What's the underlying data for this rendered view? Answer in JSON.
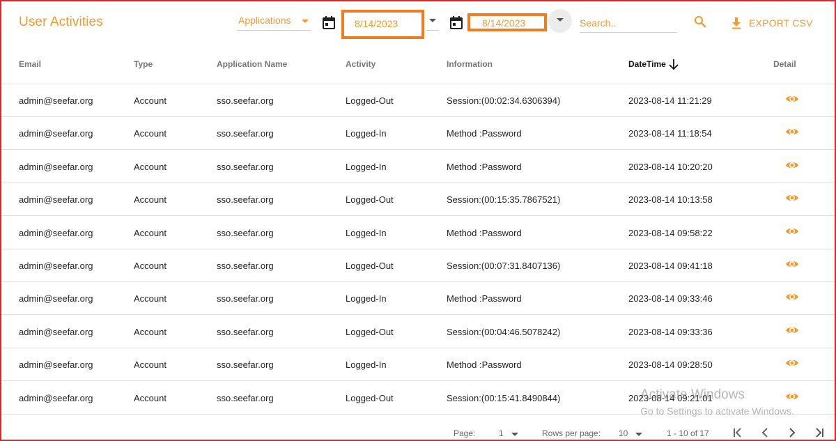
{
  "page_title": "User Activities",
  "filters": {
    "application_select": "Applications",
    "date_from": "8/14/2023",
    "date_to": "8/14/2023",
    "search_placeholder": "Search..",
    "export_label": "EXPORT CSV"
  },
  "table": {
    "headers": {
      "email": "Email",
      "type": "Type",
      "application": "Application Name",
      "activity": "Activity",
      "information": "Information",
      "datetime": "DateTime",
      "detail": "Detail"
    },
    "sort": {
      "column": "datetime",
      "direction": "descending"
    },
    "rows": [
      {
        "email": "admin@seefar.org",
        "type": "Account",
        "application": "sso.seefar.org",
        "activity": "Logged-Out",
        "information": "Session:(00:02:34.6306394)",
        "datetime": "2023-08-14 11:21:29"
      },
      {
        "email": "admin@seefar.org",
        "type": "Account",
        "application": "sso.seefar.org",
        "activity": "Logged-In",
        "information": "Method :Password",
        "datetime": "2023-08-14 11:18:54"
      },
      {
        "email": "admin@seefar.org",
        "type": "Account",
        "application": "sso.seefar.org",
        "activity": "Logged-In",
        "information": "Method :Password",
        "datetime": "2023-08-14 10:20:20"
      },
      {
        "email": "admin@seefar.org",
        "type": "Account",
        "application": "sso.seefar.org",
        "activity": "Logged-Out",
        "information": "Session:(00:15:35.7867521)",
        "datetime": "2023-08-14 10:13:58"
      },
      {
        "email": "admin@seefar.org",
        "type": "Account",
        "application": "sso.seefar.org",
        "activity": "Logged-In",
        "information": "Method :Password",
        "datetime": "2023-08-14 09:58:22"
      },
      {
        "email": "admin@seefar.org",
        "type": "Account",
        "application": "sso.seefar.org",
        "activity": "Logged-Out",
        "information": "Session:(00:07:31.8407136)",
        "datetime": "2023-08-14 09:41:18"
      },
      {
        "email": "admin@seefar.org",
        "type": "Account",
        "application": "sso.seefar.org",
        "activity": "Logged-In",
        "information": "Method :Password",
        "datetime": "2023-08-14 09:33:46"
      },
      {
        "email": "admin@seefar.org",
        "type": "Account",
        "application": "sso.seefar.org",
        "activity": "Logged-Out",
        "information": "Session:(00:04:46.5078242)",
        "datetime": "2023-08-14 09:33:36"
      },
      {
        "email": "admin@seefar.org",
        "type": "Account",
        "application": "sso.seefar.org",
        "activity": "Logged-In",
        "information": "Method :Password",
        "datetime": "2023-08-14 09:28:50"
      },
      {
        "email": "admin@seefar.org",
        "type": "Account",
        "application": "sso.seefar.org",
        "activity": "Logged-Out",
        "information": "Session:(00:15:41.8490844)",
        "datetime": "2023-08-14 09:21:01"
      }
    ]
  },
  "pagination": {
    "page_label": "Page:",
    "page_value": "1",
    "rows_label": "Rows per page:",
    "rows_value": "10",
    "range": "1 - 10 of 17"
  },
  "watermark": {
    "line1": "Activate Windows",
    "line2": "Go to Settings to activate Windows."
  },
  "colors": {
    "accent": "#f39a2e",
    "highlight_border": "#f07c22",
    "frame_border": "#e02424"
  },
  "icons": [
    "calendar-icon",
    "search-icon",
    "download-icon",
    "arrow-down-icon",
    "eye-icon",
    "first-page-icon",
    "prev-page-icon",
    "next-page-icon",
    "last-page-icon",
    "chevron-down-icon"
  ]
}
